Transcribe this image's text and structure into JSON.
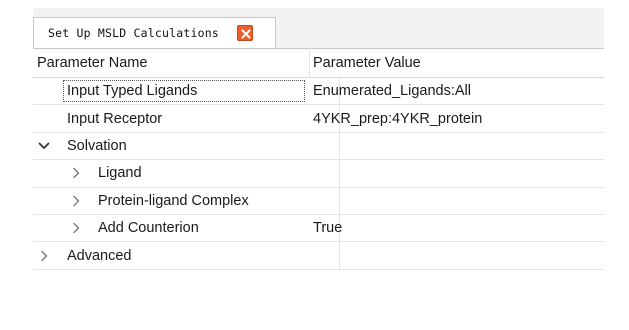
{
  "tab": {
    "label": "Set Up MSLD Calculations",
    "close_icon": "close-icon"
  },
  "table": {
    "headers": {
      "name": "Parameter Name",
      "value": "Parameter Value"
    },
    "rows": [
      {
        "name": "Input Typed Ligands",
        "value": "Enumerated_Ligands:All"
      },
      {
        "name": "Input Receptor",
        "value": "4YKR_prep:4YKR_protein"
      },
      {
        "name": "Solvation",
        "value": "",
        "expander": "chevron-down-icon"
      },
      {
        "name": "Ligand",
        "value": "",
        "expander": "chevron-right-icon"
      },
      {
        "name": "Protein-ligand Complex",
        "value": "",
        "expander": "chevron-right-icon"
      },
      {
        "name": "Add Counterion",
        "value": "True",
        "expander": "chevron-right-icon"
      },
      {
        "name": "Advanced",
        "value": "",
        "expander": "chevron-right-icon"
      }
    ]
  },
  "colors": {
    "close_button": "#e8602c",
    "tabbar_bg": "#f2f2f2",
    "grid_line": "#e4e4e4"
  }
}
